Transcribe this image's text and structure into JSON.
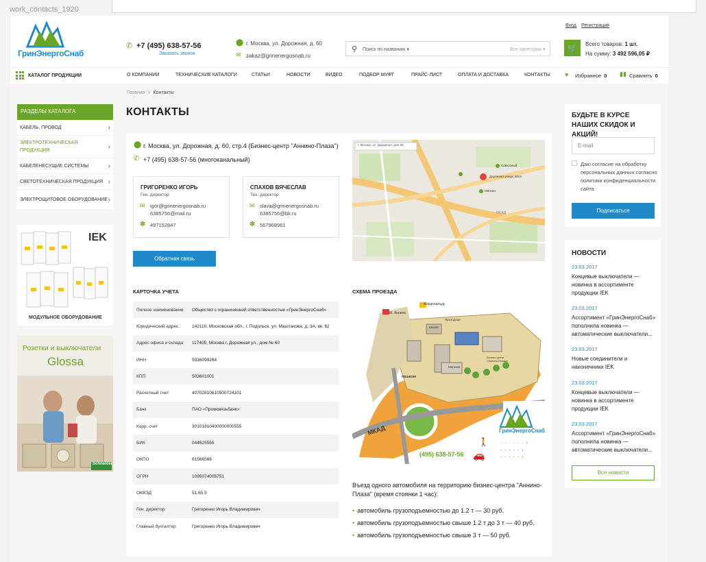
{
  "frame_label": "work_contacts_1920",
  "header": {
    "logo_text": "ГринЭнергоСнаб",
    "phone": "+7 (495) 638-57-56",
    "callback": "Заказать звонок",
    "address": "г. Москва, ул. Дорожная, д. 60",
    "email": "zakaz@grinenergosnab.ru",
    "search_placeholder": "Поиск по названию",
    "search_category": "Все категории",
    "login": "Вход",
    "register": "Регистрация",
    "cart_items_label": "Всего товаров:",
    "cart_items_value": "1 шт.",
    "cart_sum_label": "На сумму:",
    "cart_sum_value": "3 492 596,05 ₽"
  },
  "nav": {
    "catalog": "КАТАЛОГ ПРОДУКЦИИ",
    "items": [
      "О КОМПАНИИ",
      "ТЕХНИЧЕСКИЕ КАТАЛОГИ",
      "СТАТЬИ",
      "НОВОСТИ",
      "ВИДЕО",
      "ПОДБОР МУФТ",
      "ПРАЙС-ЛИСТ",
      "ОПЛАТА И ДОСТАВКА",
      "КОНТАКТЫ"
    ],
    "favorites": "Избранное",
    "favorites_count": "0",
    "compare": "Сравнить",
    "compare_count": "0"
  },
  "breadcrumb": {
    "home": "Главная",
    "sep": ">",
    "current": "Контакты"
  },
  "page_title": "КОНТАКТЫ",
  "sidebar": {
    "head": "РАЗДЕЛЫ КАТАЛОГА",
    "items": [
      "Кабель, провод",
      "Электротехническая продукция",
      "Кабеленесущие системы",
      "Светотехническая продукция",
      "Электрощитовое оборудование"
    ],
    "banner1_brand": "IEK",
    "banner1_caption": "МОДУЛЬНОЕ ОБОРУДОВАНИЕ",
    "banner2_line1": "Розетки и выключатели",
    "banner2_line2": "Glossa",
    "banner2_brand": "Schneider"
  },
  "contacts": {
    "address": "г. Москва, ул. Дорожная, д. 60, стр.4 (Бизнес-центр \"Аннино-Плаза\")",
    "phone": "+7 (495) 638-57-56 (многоканальный)",
    "people": [
      {
        "name": "ГРИГОРЕНКО ИГОРЬ",
        "role": "Ген. директор",
        "email": "igor@grinenergosnab.ru",
        "email2": "6385756@mail.ru",
        "icq": "497152847"
      },
      {
        "name": "СПАХОВ ВЯЧЕСЛАВ",
        "role": "Тех. директор",
        "email": "slava@grinenergosnab.ru",
        "email2": "6385756@bk.ru",
        "icq": "567968961"
      }
    ],
    "feedback": "Обратная связь",
    "map_search": "г. Москва, ул. Дорожная, дом 60",
    "map_label": "Дорожная улица, 60с4",
    "map_labels": [
      "Совхозный",
      "Мясная",
      "МКАД"
    ]
  },
  "card": {
    "title": "КАРТОЧКА УЧЕТА",
    "rows": [
      {
        "k": "Полное наименование",
        "v": "Общество с ограниченной ответственностью «ГринЭнергоСнаб»"
      },
      {
        "k": "Юридический адрес",
        "v": "142110, Московская обл., г. Подольск, ул. Маштакова, д. 3А, кв. 62"
      },
      {
        "k": "Адрес офиса и склада",
        "v": "117405, Москва г, Дорожная ул., дом № 60"
      },
      {
        "k": "ИНН",
        "v": "5036099264"
      },
      {
        "k": "КПП",
        "v": "503601001"
      },
      {
        "k": "Расчетный счет",
        "v": "40702810610500724101"
      },
      {
        "k": "Банк",
        "v": "ПАО «Промсвязьбанк»"
      },
      {
        "k": "Корр. счет",
        "v": "30101810400000000555"
      },
      {
        "k": "БИК",
        "v": "044525555"
      },
      {
        "k": "ОКПО",
        "v": "61566566"
      },
      {
        "k": "ОГРН",
        "v": "1095074005751"
      },
      {
        "k": "ОКВЭД",
        "v": "51.65.5"
      },
      {
        "k": "Ген. директор",
        "v": "Григоренко Игорь Владимирович"
      },
      {
        "k": "Главный бухгалтер",
        "v": "Григоренко Игорь Владимирович"
      }
    ]
  },
  "scheme": {
    "title": "СХЕМА ПРОЕЗДА",
    "labels": [
      "Макдональдс",
      "М. Аннино",
      "Проходная",
      "Школа",
      "Бизнес-центр «Аннино-Плаза»",
      "Магазин",
      "МКАД",
      "ПЕШКОМ"
    ],
    "phone": "(495) 638-57-56",
    "logo": "ГринЭнергоСнаб",
    "entry": "Въезд одного автомобиля на территорию бизнес-центра \"Аннино-Плаза\" (время стоянки 1 час):",
    "rates": [
      "автомобиль грузоподъемностью до 1.2 т — 30 руб.",
      "автомобиль грузоподъемностью свыше 1.2 т до 3 т — 40 руб.",
      "автомобиль грузоподъемностью свыше 3 т — 50 руб."
    ]
  },
  "subscribe": {
    "title": "БУДЬТЕ В КУРСЕ НАШИХ СКИДОК И АКЦИЙ!",
    "placeholder": "E-mail",
    "consent": "Даю согласие на обработку персональных данных согласно политики конфиденциальности сайта",
    "button": "Подписаться"
  },
  "news": {
    "title": "НОВОСТИ",
    "items": [
      {
        "date": "23.03.2017",
        "text": "Концевые выключатели — новинка в ассортименте продукции IEK"
      },
      {
        "date": "23.03.2017",
        "text": "Ассортимент «ГринЭнергоСнаб» пополнила новинка — автоматические выключатели..."
      },
      {
        "date": "23.03.2017",
        "text": "Новые соединители и наконечники IEK"
      },
      {
        "date": "23.03.2017",
        "text": "Концевые выключатели — новинка в ассортименте продукции IEK"
      },
      {
        "date": "23.03.2017",
        "text": "Ассортимент «ГринЭнергоСнаб» пополнила новинка — автоматические выключатели..."
      }
    ],
    "all": "Все новости"
  },
  "colors": {
    "green": "#6aa626",
    "blue": "#1f8ac7"
  }
}
